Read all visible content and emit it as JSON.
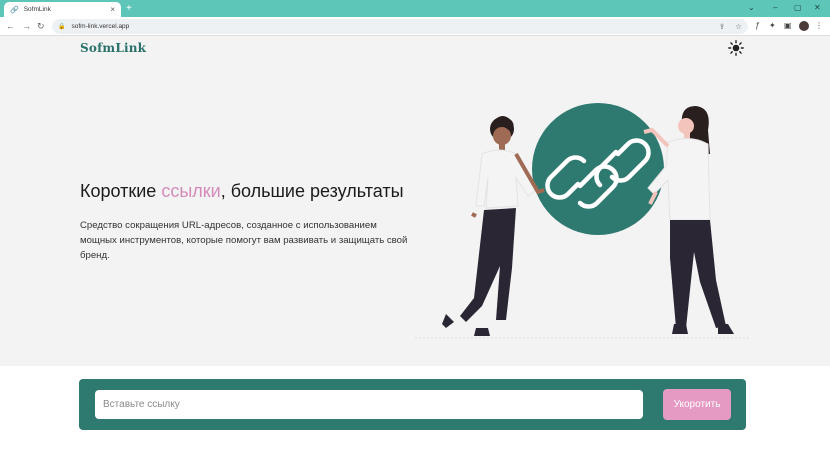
{
  "browser": {
    "tab_title": "SofmLink",
    "new_tab_symbol": "+",
    "url": "sofm-link.vercel.app",
    "colors": {
      "tabbar": "#5ec5b9"
    }
  },
  "header": {
    "logo": "SofmLink",
    "theme_icon": "sun-icon"
  },
  "hero": {
    "headline_pre": "Короткие ",
    "headline_accent": "ссылки",
    "headline_post": ", большие результаты",
    "description": "Средство сокращения URL-адресов, созданное с использованием мощных инструментов, которые помогут вам развивать и защищать свой бренд.",
    "colors": {
      "accent": "#d58bb9",
      "brand": "#2f7a70"
    }
  },
  "shortener": {
    "input_placeholder": "Вставьте ссылку",
    "input_value": "",
    "button_label": "Укоротить",
    "colors": {
      "panel": "#2f7a70",
      "button": "#e59ac3"
    }
  }
}
